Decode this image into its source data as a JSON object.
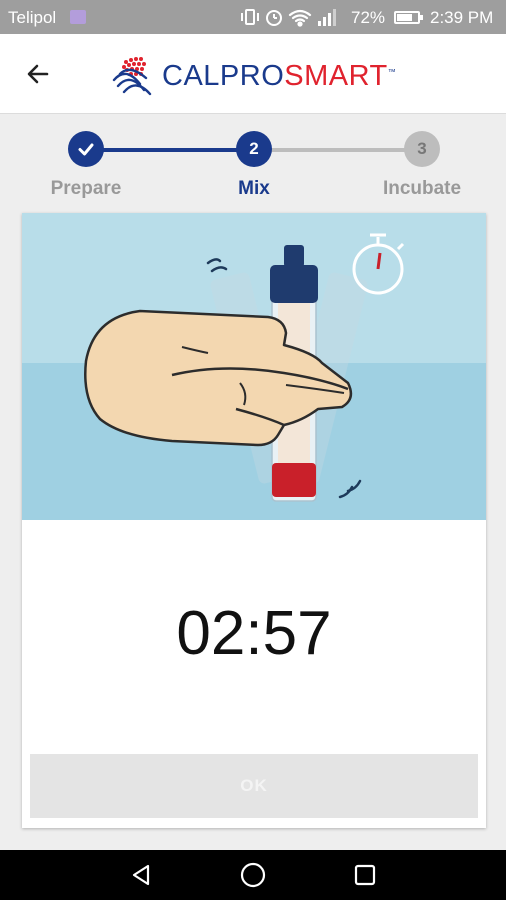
{
  "status_bar": {
    "carrier": "Telipol",
    "battery_percent": "72%",
    "time": "2:39 PM",
    "icons": [
      "vibrate-icon",
      "alarm-icon",
      "wifi-icon",
      "signal-icon",
      "battery-icon"
    ]
  },
  "app_bar": {
    "back_icon": "arrow-left-icon",
    "logo_part1": "CALPRO",
    "logo_part2": "SMART",
    "logo_tm": "™"
  },
  "stepper": {
    "steps": [
      {
        "label": "Prepare",
        "number": "",
        "state": "done"
      },
      {
        "label": "Mix",
        "number": "2",
        "state": "active"
      },
      {
        "label": "Incubate",
        "number": "3",
        "state": "pending"
      }
    ]
  },
  "card": {
    "timer": "02:57",
    "button_label": "OK"
  },
  "colors": {
    "primary": "#1a3a8c",
    "accent_red": "#e0232e",
    "pending": "#bdbdbd",
    "illustration_sky": "#b8dde9",
    "illustration_water": "#9fd0e2"
  },
  "nav_bar": {
    "icons": [
      "nav-back-icon",
      "nav-home-icon",
      "nav-recents-icon"
    ]
  }
}
